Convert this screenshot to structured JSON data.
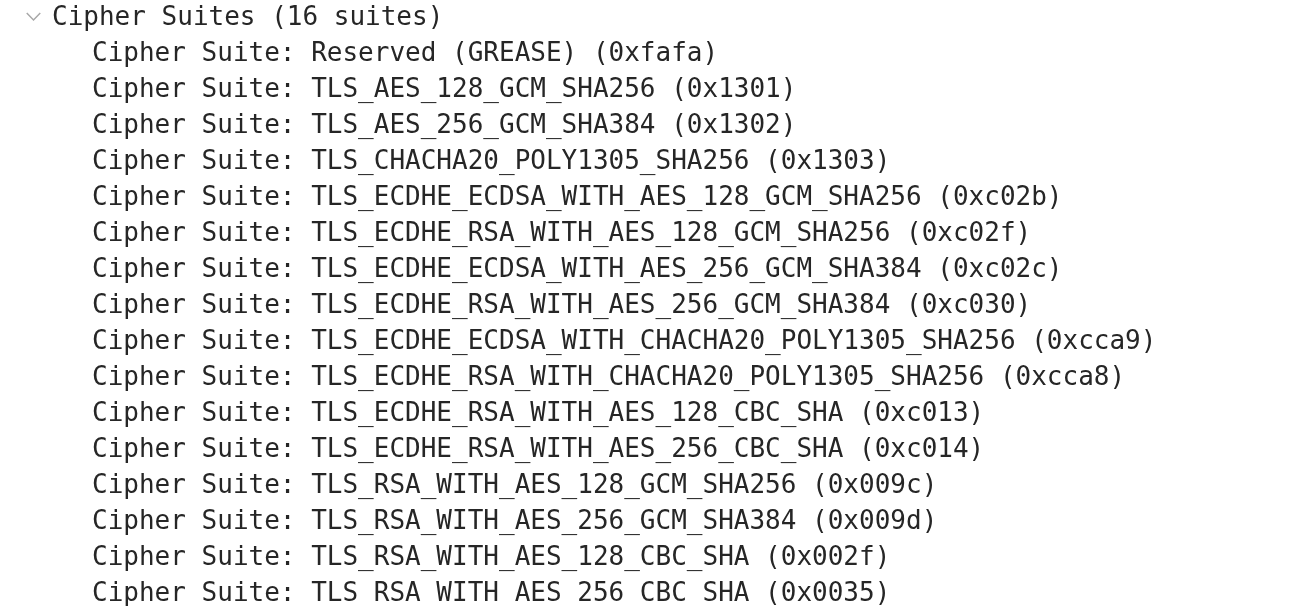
{
  "tree": {
    "label": "Cipher Suites (16 suites)",
    "expanded": true,
    "children": [
      {
        "label": "Cipher Suite: Reserved (GREASE) (0xfafa)"
      },
      {
        "label": "Cipher Suite: TLS_AES_128_GCM_SHA256 (0x1301)"
      },
      {
        "label": "Cipher Suite: TLS_AES_256_GCM_SHA384 (0x1302)"
      },
      {
        "label": "Cipher Suite: TLS_CHACHA20_POLY1305_SHA256 (0x1303)"
      },
      {
        "label": "Cipher Suite: TLS_ECDHE_ECDSA_WITH_AES_128_GCM_SHA256 (0xc02b)"
      },
      {
        "label": "Cipher Suite: TLS_ECDHE_RSA_WITH_AES_128_GCM_SHA256 (0xc02f)"
      },
      {
        "label": "Cipher Suite: TLS_ECDHE_ECDSA_WITH_AES_256_GCM_SHA384 (0xc02c)"
      },
      {
        "label": "Cipher Suite: TLS_ECDHE_RSA_WITH_AES_256_GCM_SHA384 (0xc030)"
      },
      {
        "label": "Cipher Suite: TLS_ECDHE_ECDSA_WITH_CHACHA20_POLY1305_SHA256 (0xcca9)"
      },
      {
        "label": "Cipher Suite: TLS_ECDHE_RSA_WITH_CHACHA20_POLY1305_SHA256 (0xcca8)"
      },
      {
        "label": "Cipher Suite: TLS_ECDHE_RSA_WITH_AES_128_CBC_SHA (0xc013)"
      },
      {
        "label": "Cipher Suite: TLS_ECDHE_RSA_WITH_AES_256_CBC_SHA (0xc014)"
      },
      {
        "label": "Cipher Suite: TLS_RSA_WITH_AES_128_GCM_SHA256 (0x009c)"
      },
      {
        "label": "Cipher Suite: TLS_RSA_WITH_AES_256_GCM_SHA384 (0x009d)"
      },
      {
        "label": "Cipher Suite: TLS_RSA_WITH_AES_128_CBC_SHA (0x002f)"
      },
      {
        "label": "Cipher Suite: TLS_RSA_WITH_AES_256_CBC_SHA (0x0035)"
      }
    ]
  }
}
